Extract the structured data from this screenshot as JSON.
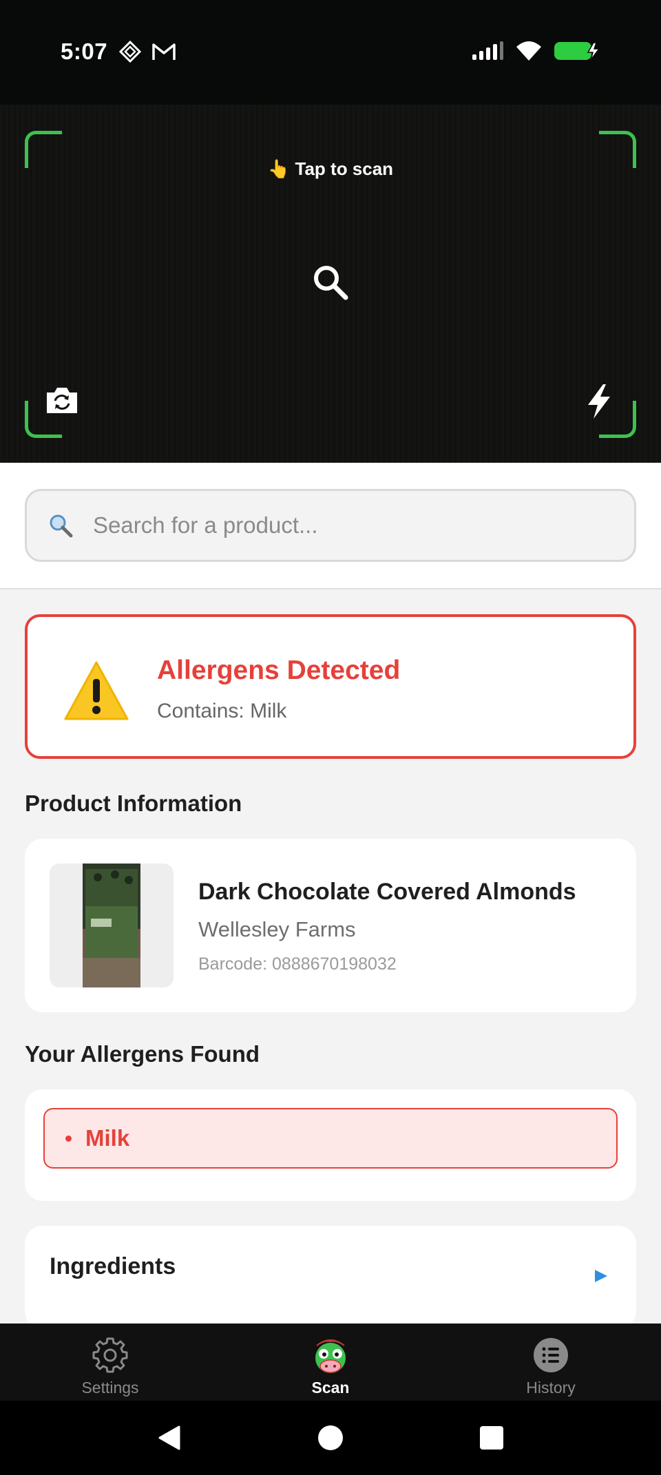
{
  "status_bar": {
    "time": "5:07",
    "left_icons": [
      "ai-diamond-icon",
      "gmail-icon"
    ],
    "right_icons": [
      "signal-icon",
      "wifi-icon",
      "battery-charging-icon"
    ],
    "battery_color": "#2ecc40"
  },
  "camera": {
    "hint": "👆 Tap to scan",
    "frame_color": "#3ec150"
  },
  "search": {
    "placeholder": "Search for a product..."
  },
  "alert": {
    "title": "Allergens Detected",
    "subtitle": "Contains: Milk",
    "color": "#e5413a"
  },
  "product_section": {
    "title": "Product Information",
    "name": "Dark Chocolate Covered Almonds",
    "brand": "Wellesley Farms",
    "barcode": "Barcode: 0888670198032"
  },
  "allergens_section": {
    "title": "Your Allergens Found",
    "items": [
      {
        "label": "Milk"
      }
    ]
  },
  "ingredients": {
    "title": "Ingredients",
    "arrow_color": "#2f8ee0"
  },
  "tabs": [
    {
      "label": "Settings",
      "icon": "gear-icon",
      "active": false
    },
    {
      "label": "Scan",
      "icon": "cow-mascot-icon",
      "active": true
    },
    {
      "label": "History",
      "icon": "list-icon",
      "active": false
    }
  ]
}
